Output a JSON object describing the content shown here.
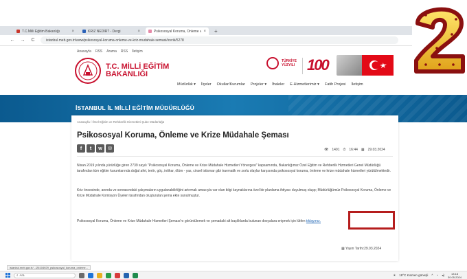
{
  "browser": {
    "tabs": [
      {
        "label": "T.C.Milli Eğitim Bakanlığı",
        "close": "×"
      },
      {
        "label": "KRİZ NEDİR? - Dergi",
        "close": "×"
      },
      {
        "label": "Psikososyal Koruma, Önleme ve...",
        "close": "×"
      }
    ],
    "new_tab": "+",
    "nav": {
      "back": "←",
      "forward": "→",
      "reload": "C"
    },
    "url": "istanbul.meb.gov.tr/www/psikososyal-koruma-onleme-ve-kriz-mudahale-semasi/icerik/5278"
  },
  "site": {
    "util_links": [
      "Anasayfa",
      "RSS",
      "Arama",
      "RSS",
      "İletişim"
    ],
    "logo_line1": "T.C. MİLLİ EĞİTİM",
    "logo_line2": "BAKANLIĞI",
    "turkiye_line1": "TÜRKİYE",
    "turkiye_line2": "YÜZYILI",
    "hundred": "100",
    "nav": [
      "Müdürlük ▾",
      "İlçeler",
      "Okullar/Kurumlar",
      "Projeler ▾",
      "İhaleler",
      "E-Hizmetlerimiz ▾",
      "Fatih Projesi",
      "İletişim"
    ],
    "banner_title": "İSTANBUL İL MİLLİ EĞİTİM MÜDÜRLÜĞÜ"
  },
  "article": {
    "breadcrumb": "Anasayfa  /  Özel Eğitim ve Rehberlik Hizmetleri Şube Müdürlüğü",
    "title": "Psikososyal Koruma, Önleme ve Krize Müdahale Şeması",
    "views": "1401",
    "time": "16:44",
    "date": "29.03.2024",
    "p1": "Nisan 2019 yılında yürürlüğe giren 2739 sayılı \"Psikososyal Koruma, Önleme ve Krize Müdahale Hizmetleri Yönergesi\" kapsamında, Bakanlığımız Özel Eğitim ve Rehberlik Hizmetleri Genel Müdürlüğü tarafından tüm eğitim kurumlarında doğal afet, terör, göç, intihar, ölüm - yas, cinsel istismar gibi travmatik ve zorlu olaylar karşısında psikososyal koruma, önleme ve krize müdahale hizmetleri yürütülmektedir.",
    "p2": "Kriz öncesinde, anında ve sonrasındaki çalışmaların uygulanabilirliğini artırmak amacıyla var olan bilgi kaynaklarına özel bir planlama ihtiyacı duyulmuş oluşp; Müdürlüğümüz Psikososyal Koruma, Önleme ve Krize Müdahale Komisyon Üyeleri tarafından oluşturulan şema ekte sunulmuştur.",
    "p3_text": "Psikososyal Koruma, Önleme ve Krize Müdahale Hizmetleri Şeması'nı görüntülemek ve şemadaki alt başlıklarda bulunan dosyalara erişmek için lütfen ",
    "p3_link": "tıklayınız.",
    "pubdate": "Yayın Tarihi:29.03.2024"
  },
  "statusbar": "istanbul.meb.gov.tr/.../26104929_psikososyal_koruma_onleme...",
  "taskbar": {
    "search": "Ara",
    "weather": "18°C  Kısmen güneşli",
    "time": "13:18",
    "date": "30.05.2024"
  },
  "colors": {
    "brand_red": "#c8102e",
    "banner_blue": "#0b5a8f",
    "link_blue": "#1a62b3",
    "highlight": "#b51d1d"
  }
}
